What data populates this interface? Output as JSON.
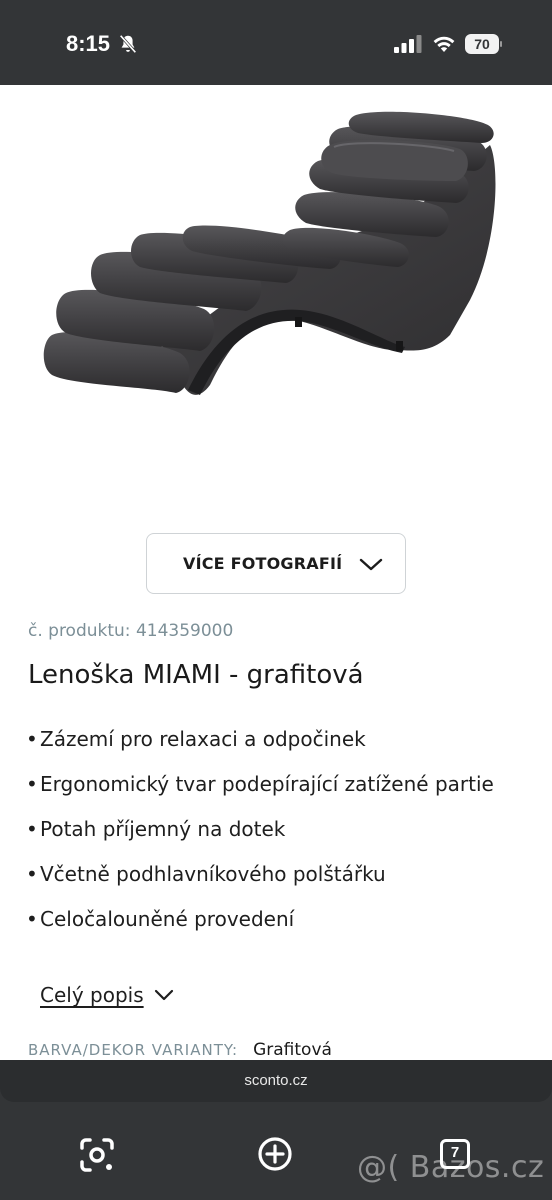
{
  "status_bar": {
    "time": "8:15",
    "battery": "70",
    "icons": [
      "bell-slash-icon",
      "signal-icon",
      "wifi-icon",
      "battery-icon"
    ]
  },
  "product": {
    "image_alt": "chaise-lounge-image",
    "more_photos_label": "VÍCE FOTOGRAFIÍ",
    "product_number": "č. produktu: 414359000",
    "title": "Lenoška MIAMI - grafitová",
    "features": [
      "Zázemí pro relaxaci a odpočinek",
      "Ergonomický tvar podepírající zatížené partie",
      "Potah příjemný na dotek",
      "Včetně podhlavníkového polštářku",
      "Celočalouněné provedení"
    ],
    "full_description_label": "Celý popis",
    "variant_label": "BARVA/DEKOR VARIANTY:",
    "variant_value": "Grafitová"
  },
  "browser": {
    "url": "sconto.cz",
    "tabs_count": "7"
  },
  "watermark": "@( Bazos.cz",
  "colors": {
    "chrome": "#333537",
    "muted_text": "#7c8f97",
    "fabric": "#3e3d3f"
  }
}
